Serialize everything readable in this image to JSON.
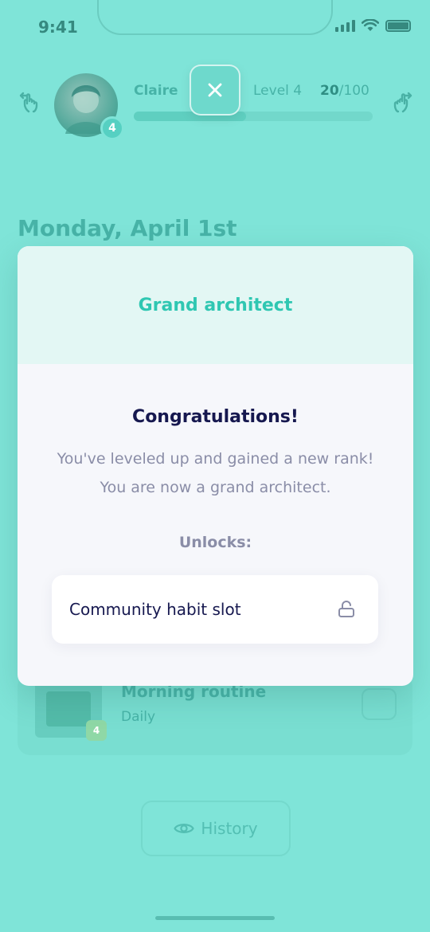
{
  "status_bar": {
    "time": "9:41"
  },
  "profile": {
    "name": "Claire",
    "avatar_badge": "4",
    "level": "Level 4",
    "xp_current": "20",
    "xp_max": "/100",
    "progress": 0.47
  },
  "date_title": "Monday, April 1st",
  "habit": {
    "name": "Morning routine",
    "frequency": "Daily",
    "badge": "4"
  },
  "history_label": "History",
  "modal": {
    "title": "Grand architect",
    "heading": "Congratulations!",
    "message": "You've leveled up and gained a new rank! You are now a grand architect.",
    "unlocks_label": "Unlocks:",
    "unlock_item": "Community habit slot"
  },
  "colors": {
    "background": "#7fe4d8",
    "accent": "#2fc7b2",
    "heading": "#16184f",
    "muted": "#8a8da7"
  },
  "icons": {
    "close": "close-icon",
    "unlock": "unlock-icon",
    "eye": "eye-icon",
    "swipe_left": "swipe-left-icon",
    "swipe_right": "swipe-right-icon"
  }
}
